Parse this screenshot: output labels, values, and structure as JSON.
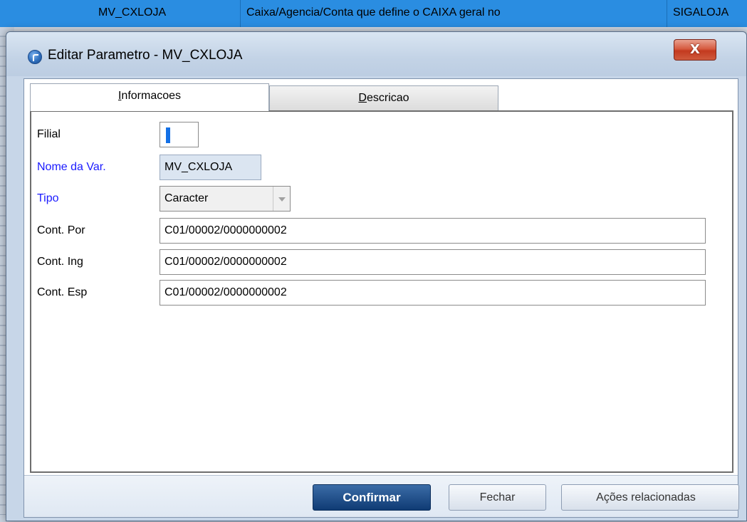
{
  "background_grid": {
    "row": {
      "var_name": "MV_CXLOJA",
      "description": "Caixa/Agencia/Conta que define o CAIXA geral no",
      "module": "SIGALOJA"
    }
  },
  "dialog": {
    "title": "Editar Parametro - MV_CXLOJA",
    "close_label": "X",
    "tabs": [
      {
        "label": "Informacoes",
        "mnemonic": "I",
        "rest": "nformacoes",
        "active": true
      },
      {
        "label": "Descricao",
        "mnemonic": "D",
        "rest": "escricao",
        "active": false
      }
    ],
    "form": {
      "filial": {
        "label": "Filial",
        "value": ""
      },
      "nome_var": {
        "label": "Nome da Var.",
        "value": "MV_CXLOJA"
      },
      "tipo": {
        "label": "Tipo",
        "value": "Caracter"
      },
      "cont_por": {
        "label": "Cont. Por",
        "value": "C01/00002/0000000002"
      },
      "cont_ing": {
        "label": "Cont. Ing",
        "value": "C01/00002/0000000002"
      },
      "cont_esp": {
        "label": "Cont. Esp",
        "value": "C01/00002/0000000002"
      }
    },
    "buttons": {
      "confirm": "Confirmar",
      "close": "Fechar",
      "related_actions": "Ações relacionadas"
    }
  },
  "colors": {
    "selection_row": "#2a8de1",
    "required_label": "#1a1aff",
    "primary_button": "#0f3b74",
    "close_button": "#c33a1f"
  }
}
